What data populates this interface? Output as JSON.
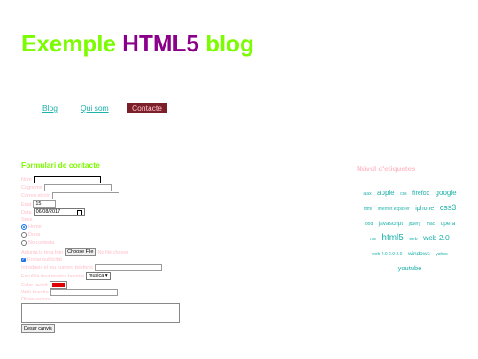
{
  "header": {
    "title_start": "Exemple ",
    "title_mid": "HTML5",
    "title_end": " blog"
  },
  "nav": {
    "items": [
      "Blog",
      "Qui som",
      "Contacte"
    ]
  },
  "form": {
    "title": "Formulari de contacte",
    "name_label": "Nom",
    "surname_label": "Cognoms",
    "email_label": "Correu electr.",
    "age_label": "Edat",
    "age_value": "15",
    "date_label": "Data",
    "date_value": "06/08/2017",
    "sex_label": "Sexe",
    "sex_options": [
      "Home",
      "Dona",
      "No contesta"
    ],
    "file_label": "Adjunta la teva foto",
    "file_button": "Choose File",
    "file_status": "No file chosen",
    "publicity_label": "Enviar publicitat",
    "phone_label": "Introdueix el teu numero telefonic",
    "music_label": "Escull la teva musica favorita",
    "music_value": "musica",
    "color_label": "Color favorit",
    "color_value": "#e00000",
    "web_label": "Web favorita",
    "notes_label": "Observacions",
    "submit_label": "Desar canvis"
  },
  "sidebar": {
    "title": "Núvol d'etiquetes",
    "tags": [
      {
        "label": "ajax",
        "size": 5
      },
      {
        "label": "apple",
        "size": 8
      },
      {
        "label": "css",
        "size": 5
      },
      {
        "label": "firefox",
        "size": 7
      },
      {
        "label": "google",
        "size": 8
      },
      {
        "label": "html",
        "size": 5
      },
      {
        "label": "internet explorer",
        "size": 5
      },
      {
        "label": "iphone",
        "size": 7
      },
      {
        "label": "css3",
        "size": 9
      },
      {
        "label": "ipod",
        "size": 5
      },
      {
        "label": "javascript",
        "size": 6.5
      },
      {
        "label": "jquery",
        "size": 5
      },
      {
        "label": "mac",
        "size": 5
      },
      {
        "label": "opera",
        "size": 6.5
      },
      {
        "label": "rss",
        "size": 5
      },
      {
        "label": "html5",
        "size": 10
      },
      {
        "label": "web",
        "size": 5
      },
      {
        "label": "web 2.0",
        "size": 8.5
      },
      {
        "label": "web 2.0 2.0 2.0",
        "size": 5
      },
      {
        "label": "windows",
        "size": 6.5
      },
      {
        "label": "yahoo",
        "size": 5
      },
      {
        "label": "youtube",
        "size": 7.5
      }
    ]
  }
}
